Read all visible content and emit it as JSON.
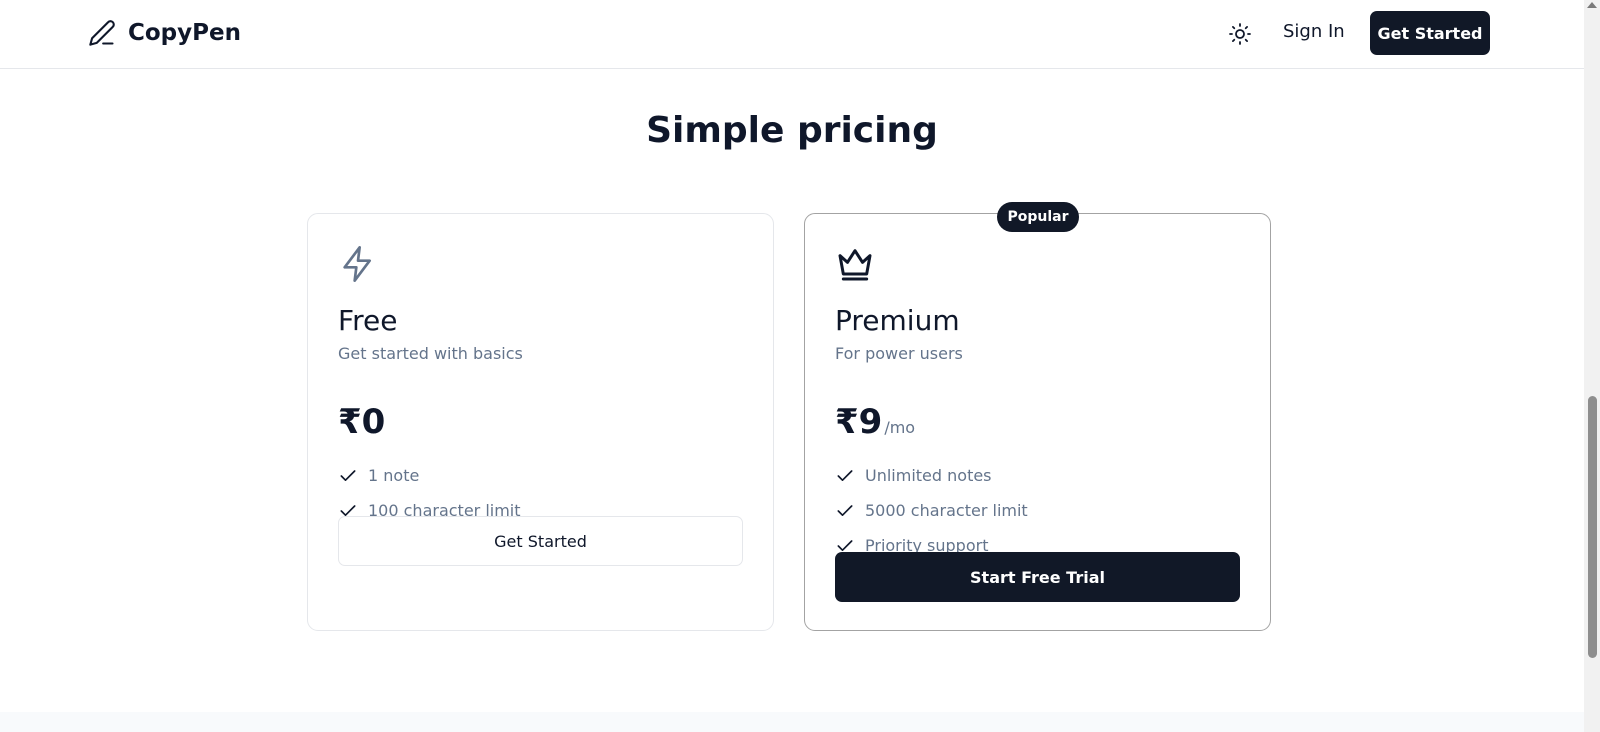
{
  "header": {
    "brand_name": "CopyPen",
    "brand_icon": "pen-icon",
    "theme_icon": "sun-icon",
    "sign_in_label": "Sign In",
    "get_started_label": "Get Started"
  },
  "pricing": {
    "title": "Simple pricing",
    "plans": [
      {
        "icon": "lightning-icon",
        "name": "Free",
        "description": "Get started with basics",
        "price": "₹0",
        "period": "",
        "features": [
          "1 note",
          "100 character limit"
        ],
        "cta_label": "Get Started"
      },
      {
        "icon": "crown-icon",
        "badge": "Popular",
        "name": "Premium",
        "description": "For power users",
        "price": "₹9",
        "period": "/mo",
        "features": [
          "Unlimited notes",
          "5000 character limit",
          "Priority support"
        ],
        "cta_label": "Start Free Trial"
      }
    ]
  },
  "colors": {
    "primary": "#111827",
    "text": "#0f172a",
    "muted": "#64748b",
    "border": "#e5e7eb",
    "lightning_icon": "#64748b"
  }
}
